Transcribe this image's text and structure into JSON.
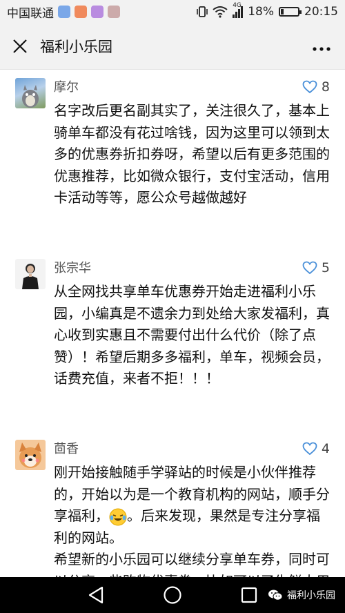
{
  "status_bar": {
    "carrier": "中国联通",
    "battery": "18%",
    "battery_level": 0.18,
    "time": "20:15",
    "network": "4G"
  },
  "header": {
    "title": "福利小乐园",
    "close_icon": "close-icon",
    "more_icon": "more-icon"
  },
  "comments": [
    {
      "name": "摩尔",
      "likes": "8",
      "text": "名字改后更名副其实了，关注很久了，基本上骑单车都没有花过啥钱，因为这里可以领到太多的优惠券折扣券呀，希望以后有更多范围的优惠推荐，比如微众银行，支付宝活动，信用卡活动等等，愿公众号越做越好"
    },
    {
      "name": "张宗华",
      "likes": "5",
      "text": "从全网找共享单车优惠券开始走进福利小乐园，小编真是不遗余力到处给大家发福利，真心收到实惠且不需要付出什么代价（除了点赞）！希望后期多多福利，单车，视频会员，话费充值，来者不拒！！！"
    },
    {
      "name": "茴香",
      "likes": "4",
      "text_part1": "刚开始接触随手学驿站的时候是小伙伴推荐的，开始以为是一个教育机构的网站，顺手分享福利，",
      "text_part2": "。后来发现，果然是专注分享福利的网站。",
      "text_part3": "希望新的小乐园可以继续分享单车券，同时可以分享一些购物优惠券。比如可以了生鲜大用的一些优惠券"
    }
  ],
  "nav_bar": {
    "watermark": "福利小乐园"
  },
  "colors": {
    "bar_bg": "#f2f2f2",
    "like_heart": "#4a90d9",
    "nav_bg": "#000000"
  }
}
